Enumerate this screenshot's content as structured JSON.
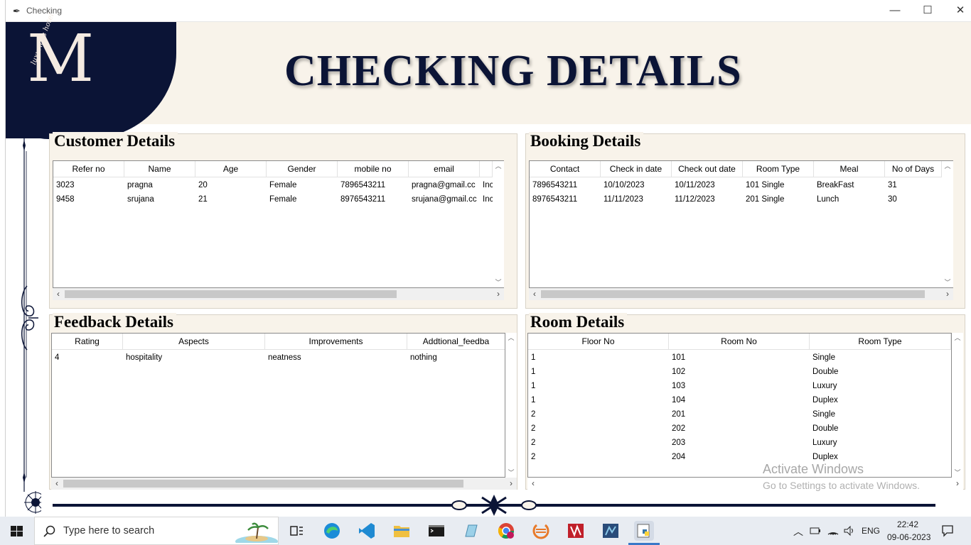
{
  "window": {
    "title": "Checking",
    "minimize": "—",
    "maximize": "☐",
    "close": "✕"
  },
  "header": {
    "title": "CHECKING DETAILS",
    "logo_letter": "M",
    "logo_script": "luxurious hotel"
  },
  "customer": {
    "title": "Customer Details",
    "columns": [
      "Refer no",
      "Name",
      "Age",
      "Gender",
      "mobile no",
      "email",
      ""
    ],
    "rows": [
      [
        "3023",
        "pragna",
        "20",
        "Female",
        "7896543211",
        "pragna@gmail.cc",
        "Inc"
      ],
      [
        "9458",
        "srujana",
        "21",
        "Female",
        "8976543211",
        "srujana@gmail.cc",
        "Inc"
      ]
    ]
  },
  "booking": {
    "title": "Booking Details",
    "columns": [
      "Contact",
      "Check in date",
      "Check out date",
      "Room Type",
      "Meal",
      "No of Days"
    ],
    "rows": [
      [
        "7896543211",
        "10/10/2023",
        "10/11/2023",
        "101 Single",
        "BreakFast",
        "31"
      ],
      [
        "8976543211",
        "11/11/2023",
        "11/12/2023",
        "201 Single",
        "Lunch",
        "30"
      ]
    ]
  },
  "feedback": {
    "title": "Feedback Details",
    "columns": [
      "Rating",
      "Aspects",
      "Improvements",
      "Addtional_feedba"
    ],
    "rows": [
      [
        "4",
        "hospitality",
        "neatness",
        "nothing"
      ]
    ]
  },
  "rooms": {
    "title": "Room Details",
    "columns": [
      "Floor No",
      "Room No",
      "Room Type"
    ],
    "rows": [
      [
        "1",
        "101",
        "Single"
      ],
      [
        "1",
        "102",
        "Double"
      ],
      [
        "1",
        "103",
        "Luxury"
      ],
      [
        "1",
        "104",
        "Duplex"
      ],
      [
        "2",
        "201",
        "Single"
      ],
      [
        "2",
        "202",
        "Double"
      ],
      [
        "2",
        "203",
        "Luxury"
      ],
      [
        "2",
        "204",
        "Duplex"
      ]
    ]
  },
  "watermark": {
    "line1": "Activate Windows",
    "line2": "Go to Settings to activate Windows."
  },
  "taskbar": {
    "search_placeholder": "Type here to search",
    "language": "ENG",
    "time": "22:42",
    "date": "09-06-2023"
  },
  "colors": {
    "navy": "#0b1436",
    "cream": "#f8f3ea"
  }
}
